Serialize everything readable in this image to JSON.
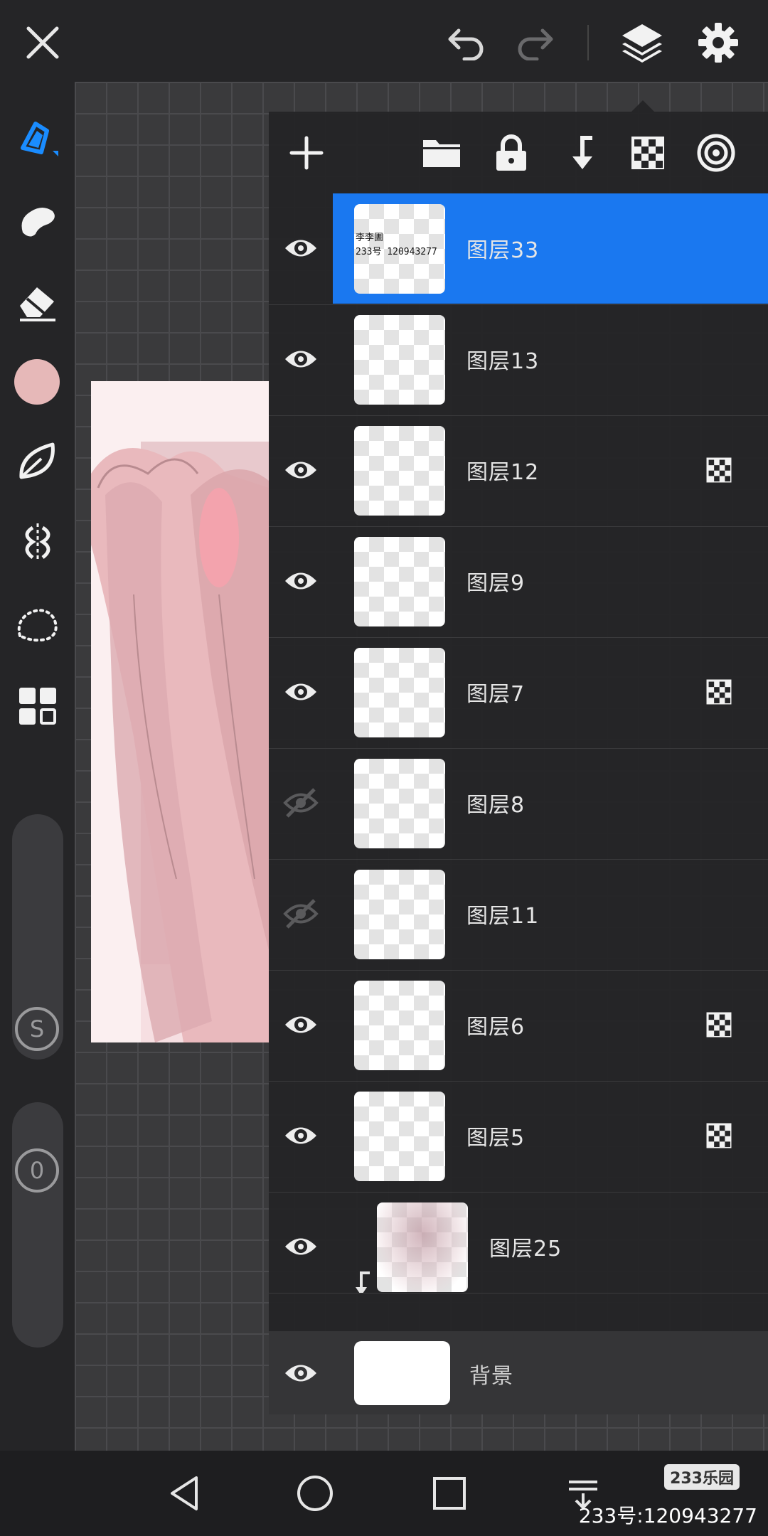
{
  "layers": [
    {
      "name": "图层33",
      "visible": true,
      "selected": true,
      "alpha_lock": false,
      "thumb_text": "李李圕\n233号 120943277"
    },
    {
      "name": "图层13",
      "visible": true,
      "selected": false,
      "alpha_lock": false
    },
    {
      "name": "图层12",
      "visible": true,
      "selected": false,
      "alpha_lock": true
    },
    {
      "name": "图层9",
      "visible": true,
      "selected": false,
      "alpha_lock": false
    },
    {
      "name": "图层7",
      "visible": true,
      "selected": false,
      "alpha_lock": true
    },
    {
      "name": "图层8",
      "visible": false,
      "selected": false,
      "alpha_lock": false
    },
    {
      "name": "图层11",
      "visible": false,
      "selected": false,
      "alpha_lock": false
    },
    {
      "name": "图层6",
      "visible": true,
      "selected": false,
      "alpha_lock": true
    },
    {
      "name": "图层5",
      "visible": true,
      "selected": false,
      "alpha_lock": true
    },
    {
      "name": "图层25",
      "visible": true,
      "selected": false,
      "alpha_lock": false,
      "clipped": true
    }
  ],
  "background_layer": {
    "name": "背景",
    "visible": true
  },
  "toolbar": {
    "size_value": "S",
    "opacity_value": "0",
    "color": "#e6b8b8"
  },
  "accent_color": "#1a78f0",
  "watermark": {
    "logo": "233乐园",
    "text": "233号:120943277"
  }
}
